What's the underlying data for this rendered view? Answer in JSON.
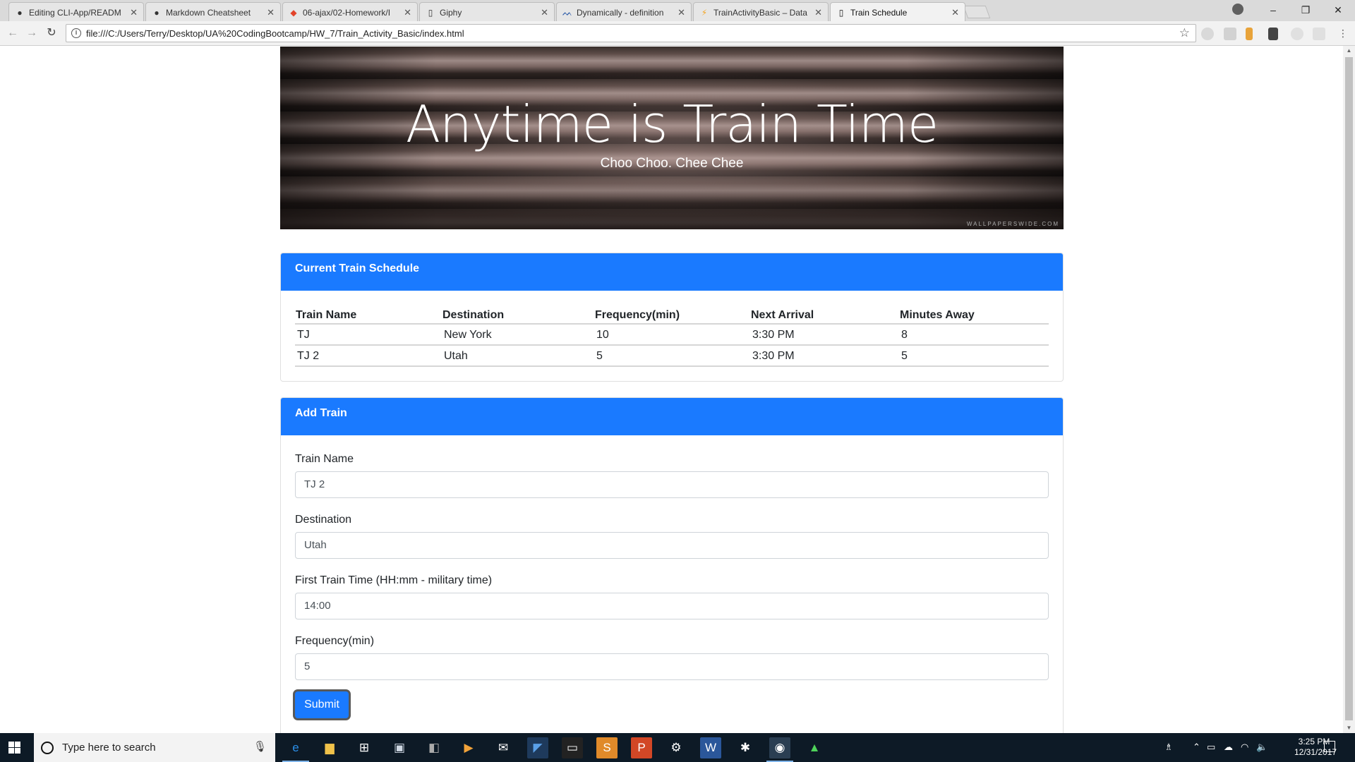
{
  "browser": {
    "tabs": [
      {
        "label": "Editing CLI-App/READM",
        "icon": "github-icon"
      },
      {
        "label": "Markdown Cheatsheet",
        "icon": "github-icon"
      },
      {
        "label": "06-ajax/02-Homework/I",
        "icon": "gitlab-icon"
      },
      {
        "label": "Giphy",
        "icon": "page-icon"
      },
      {
        "label": "Dynamically - definition",
        "icon": "dictionary-icon"
      },
      {
        "label": "TrainActivityBasic – Data",
        "icon": "firebase-icon"
      },
      {
        "label": "Train Schedule",
        "icon": "page-icon"
      }
    ],
    "url": "file:///C:/Users/Terry/Desktop/UA%20CodingBootcamp/HW_7/Train_Activity_Basic/index.html"
  },
  "page": {
    "title": "Anytime is Train Time",
    "subtitle": "Choo Choo. Chee Chee",
    "watermark": "WALLPAPERSWIDE.COM",
    "schedule": {
      "header": "Current Train Schedule",
      "columns": [
        "Train Name",
        "Destination",
        "Frequency(min)",
        "Next Arrival",
        "Minutes Away"
      ],
      "rows": [
        [
          "TJ",
          "New York",
          "10",
          "3:30 PM",
          "8"
        ],
        [
          "TJ 2",
          "Utah",
          "5",
          "3:30 PM",
          "5"
        ]
      ]
    },
    "form": {
      "header": "Add Train",
      "train_name_label": "Train Name",
      "train_name_value": "TJ 2",
      "destination_label": "Destination",
      "destination_value": "Utah",
      "first_time_label": "First Train Time (HH:mm - military time)",
      "first_time_value": "14:00",
      "frequency_label": "Frequency(min)",
      "frequency_value": "5",
      "submit_label": "Submit"
    }
  },
  "taskbar": {
    "search_placeholder": "Type here to search",
    "time": "3:25 PM",
    "date": "12/31/2017",
    "accent": "#1a7aff"
  }
}
